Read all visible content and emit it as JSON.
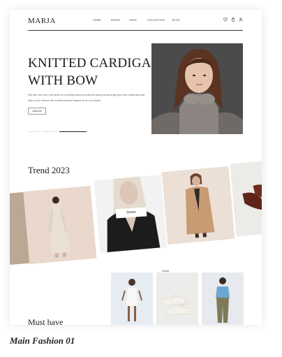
{
  "header": {
    "logo": "MARJA",
    "nav": [
      "HOME",
      "PAGES",
      "SHOP",
      "COLLECTION",
      "BLOG"
    ],
    "icons": [
      "heart-icon",
      "cart-icon",
      "user-icon"
    ]
  },
  "hero": {
    "title_line1": "KNITTED CARDIGAN",
    "title_line2": "WITH BOW",
    "body": "We use the Join Life label on clothing that is produced using technology and raw materials that help us to reduce the environmental impact of our products.",
    "button": "Discover"
  },
  "trend": {
    "title": "Trend 2023",
    "button": "Dress"
  },
  "musthave": {
    "title": "Must have",
    "tag": "TREND"
  },
  "caption": "Main Fashion 01",
  "colors": {
    "text": "#1a1a1a",
    "accent": "#222222",
    "beige_panel": "#ead8cc"
  }
}
